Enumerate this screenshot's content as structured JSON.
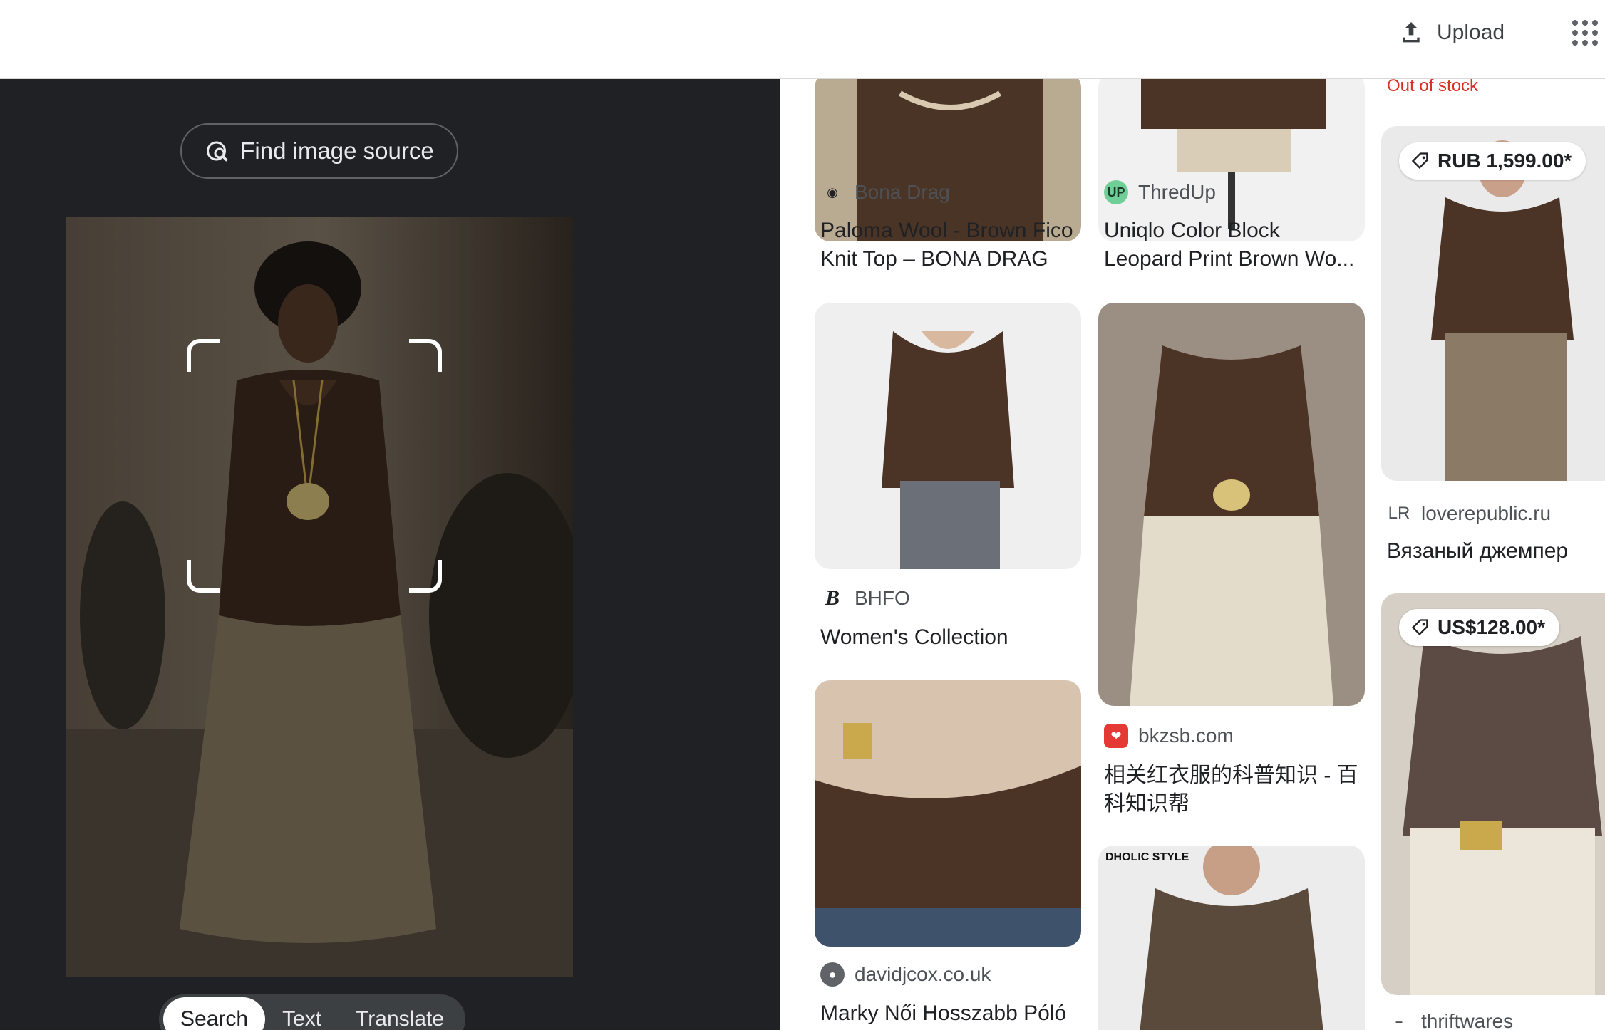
{
  "header": {
    "upload_label": "Upload",
    "upload_icon": "upload-icon",
    "apps_icon": "apps-grid-icon"
  },
  "lens": {
    "find_source_label": "Find image source",
    "find_source_icon": "image-search-icon",
    "modes": [
      "Search",
      "Text",
      "Translate"
    ],
    "active_mode": "Search"
  },
  "results": {
    "col1": [
      {
        "site": "Bona Drag",
        "favicon": "eye-icon",
        "title_lines": [
          "Paloma Wool - Brown Fico",
          "Knit Top – BONA DRAG"
        ]
      },
      {
        "site": "BHFO",
        "favicon": "bhfo-logo",
        "title_lines": [
          "Women's Collection"
        ]
      },
      {
        "site": "davidjcox.co.uk",
        "favicon": "globe-icon",
        "title_lines": [
          "Marky Női Hosszabb Póló"
        ]
      }
    ],
    "col2": [
      {
        "site": "ThredUp",
        "favicon": "thredup-logo",
        "favicon_text": "UP",
        "title_lines": [
          "Uniqlo Color Block",
          "Leopard Print Brown Wo..."
        ]
      },
      {
        "site": "bkzsb.com",
        "favicon": "bkzsb-logo",
        "title_lines": [
          "相关红衣服的科普知识 - 百",
          "科知识帮"
        ]
      },
      {
        "image_label": "DHOLIC STYLE"
      }
    ],
    "col3": [
      {
        "stock": "Out of stock"
      },
      {
        "price": "RUB 1,599.00*",
        "site": "loverepublic.ru",
        "favicon_text": "LR",
        "title_lines": [
          "Вязаный джемпер"
        ]
      },
      {
        "price": "US$128.00*",
        "site": "thriftwares"
      }
    ]
  }
}
